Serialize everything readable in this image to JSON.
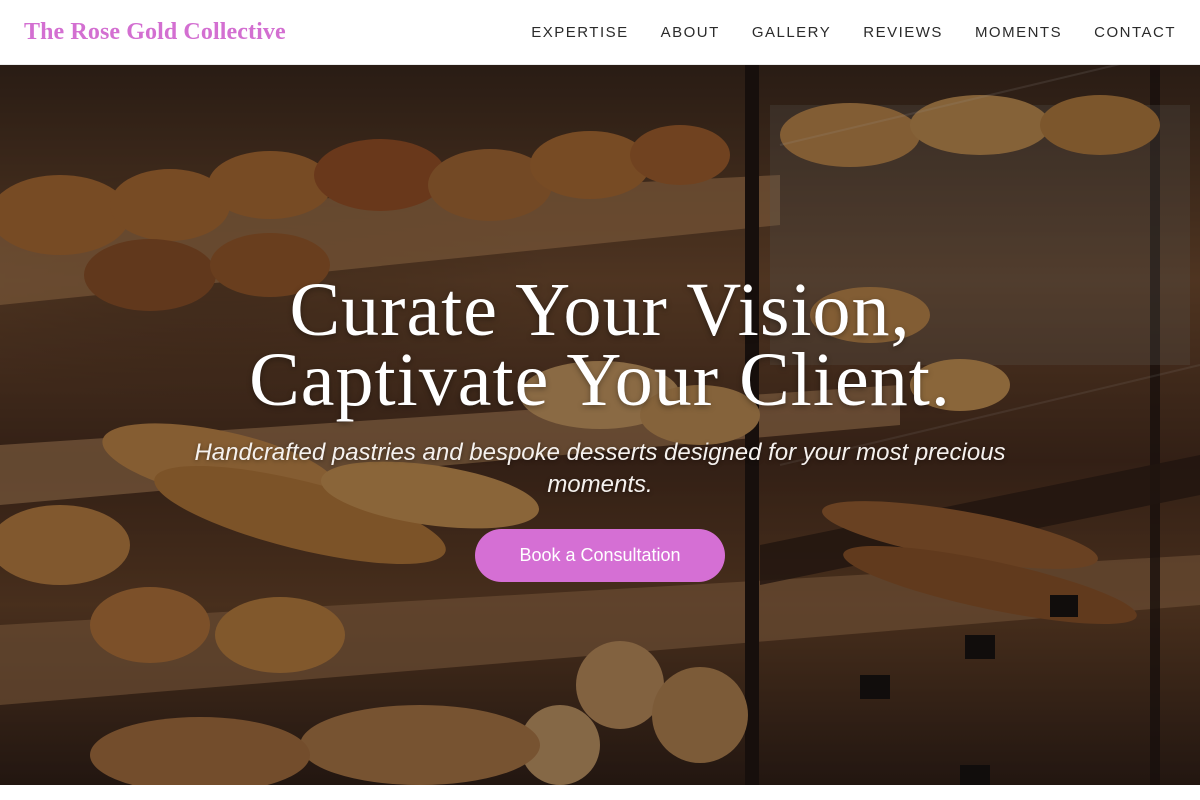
{
  "header": {
    "brand": "The Rose Gold Collective",
    "nav": [
      {
        "label": "EXPERTISE"
      },
      {
        "label": "ABOUT"
      },
      {
        "label": "GALLERY"
      },
      {
        "label": "REVIEWS"
      },
      {
        "label": "MOMENTS"
      },
      {
        "label": "CONTACT"
      }
    ]
  },
  "hero": {
    "title_line_1": "Curate Your Vision,",
    "title_line_2": "Captivate Your Client.",
    "subtitle": "Handcrafted pastries and bespoke desserts designed for your most precious moments.",
    "cta_label": "Book a Consultation"
  },
  "colors": {
    "brand": "#d36fd1",
    "cta_background": "#d56fd4",
    "nav_text": "#2b2b2b",
    "hero_text": "#ffffff"
  }
}
